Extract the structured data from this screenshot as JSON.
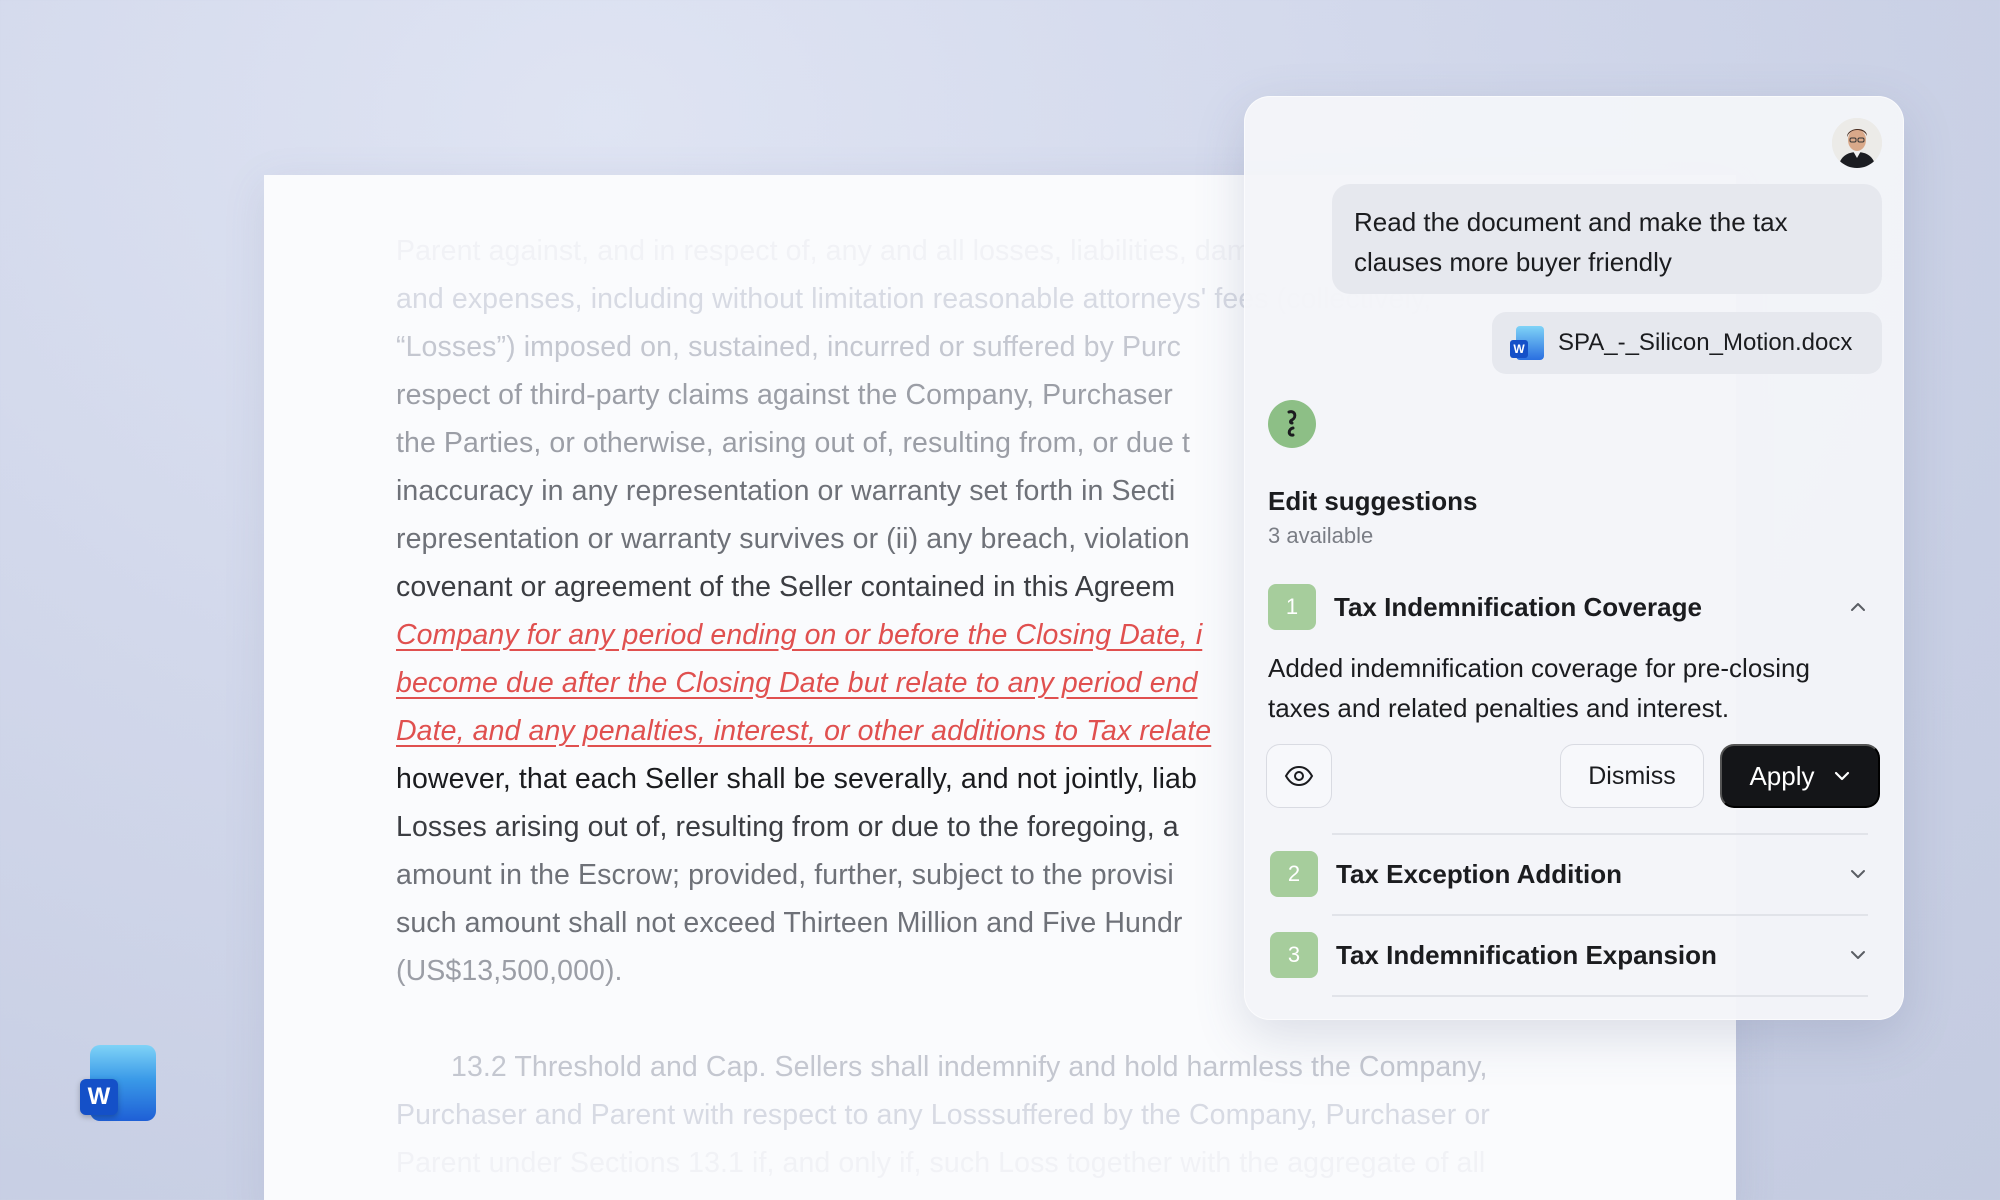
{
  "document": {
    "lines": [
      "Parent against, and in respect of, any and all losses, liabilities, damages, deficiencies, costs",
      "and expenses, including without limitation reasonable attorneys' fees (collectively,",
      "“Losses”) imposed on, sustained, incurred or suffered by Purc",
      "respect of third-party claims against the Company, Purchaser",
      "the Parties, or otherwise, arising out of, resulting from, or due t",
      "inaccuracy in any representation or warranty set forth in Secti",
      "representation or warranty survives or (ii) any breach, violation",
      "covenant or agreement of the Seller contained in this Agreem",
      "Company for any period ending on or before the Closing Date, i",
      "become due after the Closing Date but relate to any period end",
      "Date, and any penalties, interest, or other additions to Tax relate",
      "however, that each Seller shall be severally, and not jointly, liab",
      "Losses arising out of, resulting from or due to the foregoing, a",
      "amount in the Escrow; provided, further, subject to the provisi",
      "such amount shall not exceed Thirteen Million and Five Hundr",
      "(US$13,500,000).",
      "13.2 Threshold and Cap. Sellers shall indemnify and hold harmless the Company,",
      "Purchaser and Parent with respect to any Losssuffered by the Company, Purchaser or",
      "Parent under Sections 13.1 if, and only if, such Loss together with the aggregate of all"
    ]
  },
  "panel": {
    "user_message": "Read the document and make the tax clauses more buyer friendly",
    "attachment": "SPA_-_Silicon_Motion.docx",
    "suggestions_title": "Edit suggestions",
    "suggestions_count": "3 available",
    "items": [
      {
        "number": "1",
        "label": "Tax Indemnification Coverage",
        "description": "Added indemnification coverage for pre-closing taxes and related penalties and interest.",
        "expanded": true
      },
      {
        "number": "2",
        "label": "Tax Exception Addition",
        "expanded": false
      },
      {
        "number": "3",
        "label": "Tax Indemnification Expansion",
        "expanded": false
      }
    ],
    "dismiss_label": "Dismiss",
    "apply_label": "Apply"
  },
  "colors": {
    "suggestion_red": "#e0504f",
    "badge_green": "#a6cd9c",
    "bot_green": "#8dbf86",
    "apply_bg": "#141518"
  },
  "icons": [
    "word-app-icon",
    "user-avatar",
    "bot-icon",
    "chevron-up-icon",
    "chevron-down-icon",
    "eye-icon",
    "docx-file-icon"
  ]
}
